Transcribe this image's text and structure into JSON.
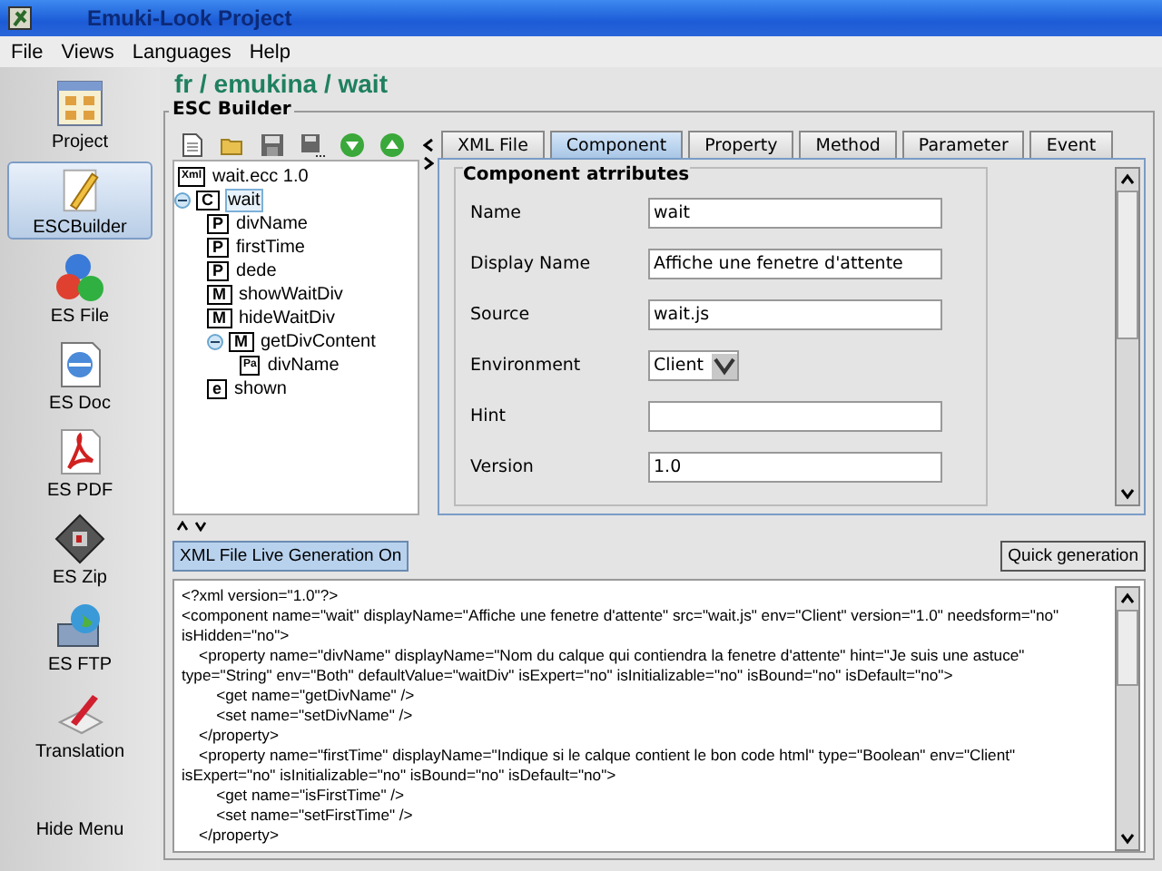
{
  "window": {
    "title": "Emuki-Look Project"
  },
  "menu": [
    "File",
    "Views",
    "Languages",
    "Help"
  ],
  "sidebar": {
    "items": [
      {
        "label": "Project",
        "kind": "project",
        "selected": false
      },
      {
        "label": "ESCBuilder",
        "kind": "builder",
        "selected": true
      },
      {
        "label": "ES File",
        "kind": "file",
        "selected": false
      },
      {
        "label": "ES Doc",
        "kind": "doc",
        "selected": false
      },
      {
        "label": "ES PDF",
        "kind": "pdf",
        "selected": false
      },
      {
        "label": "ES Zip",
        "kind": "zip",
        "selected": false
      },
      {
        "label": "ES FTP",
        "kind": "ftp",
        "selected": false
      },
      {
        "label": "Translation",
        "kind": "translation",
        "selected": false
      },
      {
        "label": "Hide Menu",
        "kind": "text",
        "selected": false
      }
    ]
  },
  "breadcrumb": "fr / emukina / wait",
  "builder": {
    "title": "ESC Builder",
    "tree": [
      {
        "label": "wait.ecc 1.0",
        "badge": "Xml",
        "selected": false
      },
      {
        "label": "wait",
        "badge": "C",
        "expanded": true,
        "selected": true,
        "children": [
          {
            "label": "divName",
            "badge": "P",
            "selected": false
          },
          {
            "label": "firstTime",
            "badge": "P",
            "selected": false
          },
          {
            "label": "dede",
            "badge": "P",
            "selected": false
          },
          {
            "label": "showWaitDiv",
            "badge": "M",
            "selected": false
          },
          {
            "label": "hideWaitDiv",
            "badge": "M",
            "selected": false
          },
          {
            "label": "getDivContent",
            "badge": "M",
            "expanded": true,
            "selected": false,
            "children": [
              {
                "label": "divName",
                "badge": "Pa",
                "selected": false
              }
            ]
          },
          {
            "label": "shown",
            "badge": "e",
            "selected": false
          }
        ]
      }
    ],
    "tabs": [
      {
        "label": "XML File",
        "selected": false
      },
      {
        "label": "Component",
        "selected": true
      },
      {
        "label": "Property",
        "selected": false
      },
      {
        "label": "Method",
        "selected": false
      },
      {
        "label": "Parameter",
        "selected": false
      },
      {
        "label": "Event",
        "selected": false
      }
    ],
    "group_title": "Component atrributes",
    "fields": [
      {
        "label": "Name",
        "value": "wait",
        "kind": "text"
      },
      {
        "label": "Display Name",
        "value": "Affiche une fenetre d'attente",
        "kind": "text"
      },
      {
        "label": "Source",
        "value": "wait.js",
        "kind": "text"
      },
      {
        "label": "Environment",
        "value": "Client",
        "kind": "select"
      },
      {
        "label": "Hint",
        "kind": "text"
      },
      {
        "label": "Version",
        "value": "1.0",
        "kind": "text"
      }
    ],
    "live_button": {
      "label": "XML File Live Generation On",
      "on": true
    },
    "quick_button": "Quick generation",
    "xml_lines": [
      "<?xml version=\"1.0\"?>",
      "<component name=\"wait\" displayName=\"Affiche une fenetre d'attente\" src=\"wait.js\" env=\"Client\" version=\"1.0\" needsform=\"no\"",
      "isHidden=\"no\">",
      "    <property name=\"divName\" displayName=\"Nom du calque qui contiendra la fenetre d'attente\" hint=\"Je suis une astuce\"",
      "type=\"String\" env=\"Both\" defaultValue=\"waitDiv\" isExpert=\"no\" isInitializable=\"no\" isBound=\"no\" isDefault=\"no\">",
      "        <get name=\"getDivName\" />",
      "        <set name=\"setDivName\" />",
      "    </property>",
      "    <property name=\"firstTime\" displayName=\"Indique si le calque contient le bon code html\" type=\"Boolean\" env=\"Client\"",
      "isExpert=\"no\" isInitializable=\"no\" isBound=\"no\" isDefault=\"no\">",
      "        <get name=\"isFirstTime\" />",
      "        <set name=\"setFirstTime\" />",
      "    </property>"
    ]
  }
}
